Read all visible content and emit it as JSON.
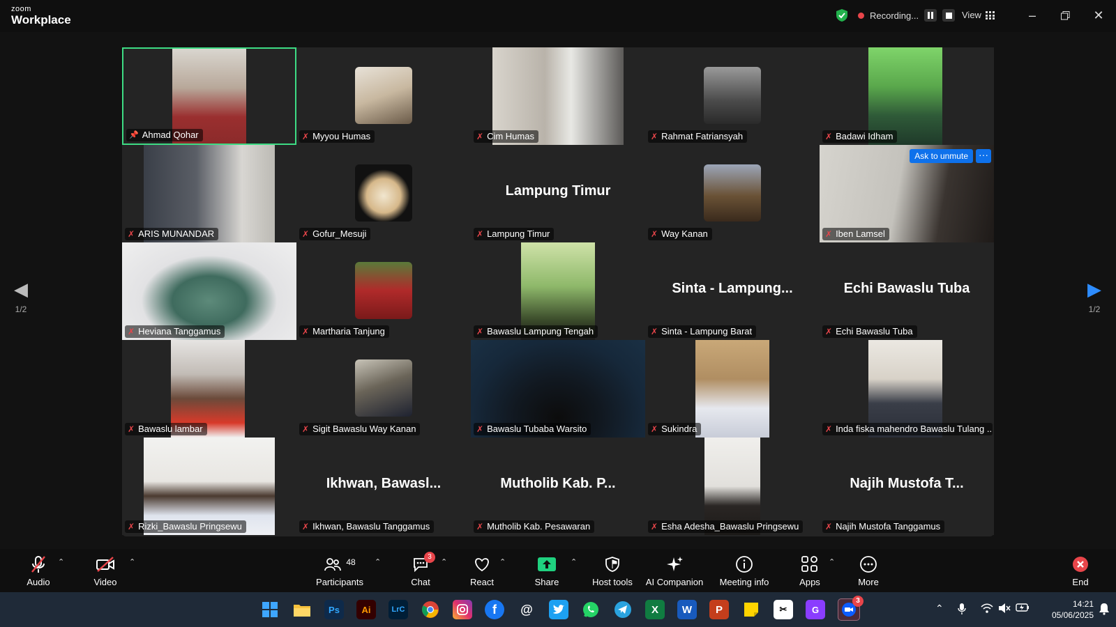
{
  "app": {
    "brand_small": "zoom",
    "brand_big": "Workplace"
  },
  "titlebar": {
    "recording_label": "Recording...",
    "view_label": "View"
  },
  "tiles": [
    {
      "name": "Ahmad Qohar",
      "big": "",
      "kind": "video",
      "active": true,
      "pinned": true
    },
    {
      "name": "Myyou Humas",
      "big": "",
      "kind": "avatar"
    },
    {
      "name": "Cim Humas",
      "big": "",
      "kind": "video"
    },
    {
      "name": "Rahmat Fatriansyah",
      "big": "",
      "kind": "avatar"
    },
    {
      "name": "Badawi Idham",
      "big": "",
      "kind": "video"
    },
    {
      "name": "ARIS MUNANDAR",
      "big": "",
      "kind": "video"
    },
    {
      "name": "Gofur_Mesuji",
      "big": "",
      "kind": "avatar"
    },
    {
      "name": "Lampung Timur",
      "big": "Lampung Timur",
      "kind": "text"
    },
    {
      "name": "Way Kanan",
      "big": "",
      "kind": "avatar"
    },
    {
      "name": "Iben Lamsel",
      "big": "",
      "kind": "video",
      "unmute": true
    },
    {
      "name": "Heviana Tanggamus",
      "big": "",
      "kind": "video"
    },
    {
      "name": "Martharia Tanjung",
      "big": "",
      "kind": "avatar"
    },
    {
      "name": "Bawaslu Lampung Tengah",
      "big": "",
      "kind": "video"
    },
    {
      "name": "Sinta - Lampung Barat",
      "big": "Sinta - Lampung...",
      "kind": "text"
    },
    {
      "name": "Echi Bawaslu Tuba",
      "big": "Echi Bawaslu Tuba",
      "kind": "text"
    },
    {
      "name": "Bawaslu lambar",
      "big": "",
      "kind": "video"
    },
    {
      "name": "Sigit Bawaslu Way Kanan",
      "big": "",
      "kind": "avatar"
    },
    {
      "name": "Bawaslu Tubaba Warsito",
      "big": "",
      "kind": "video"
    },
    {
      "name": "Sukindra",
      "big": "",
      "kind": "video"
    },
    {
      "name": "Inda fiska mahendro Bawaslu Tulang ...",
      "big": "",
      "kind": "video"
    },
    {
      "name": "Rizki_Bawaslu Pringsewu",
      "big": "",
      "kind": "video"
    },
    {
      "name": "Ikhwan, Bawaslu Tanggamus",
      "big": "Ikhwan, Bawasl...",
      "kind": "text"
    },
    {
      "name": "Mutholib Kab. Pesawaran",
      "big": "Mutholib Kab. P...",
      "kind": "text"
    },
    {
      "name": "Esha Adesha_Bawaslu Pringsewu",
      "big": "",
      "kind": "video"
    },
    {
      "name": "Najih Mustofa Tanggamus",
      "big": "Najih Mustofa T...",
      "kind": "text"
    }
  ],
  "unmute_label": "Ask to unmute",
  "unmute_more": "···",
  "paging": {
    "left": "1/2",
    "right": "1/2"
  },
  "toolbar": {
    "audio": "Audio",
    "video": "Video",
    "participants": "Participants",
    "participants_count": "48",
    "chat": "Chat",
    "chat_badge": "3",
    "react": "React",
    "share": "Share",
    "host_tools": "Host tools",
    "ai_companion": "AI Companion",
    "meeting_info": "Meeting info",
    "apps": "Apps",
    "more": "More",
    "end": "End"
  },
  "taskbar": {
    "apps": [
      "Ps",
      "Ai",
      "LrC"
    ],
    "zoom_badge": "3",
    "time": "14:21",
    "date": "05/06/2025"
  },
  "colors": {
    "accent_green": "#3ddc84",
    "mute_red": "#e8454a",
    "blue": "#0e71eb",
    "share_green": "#1fd17f"
  }
}
